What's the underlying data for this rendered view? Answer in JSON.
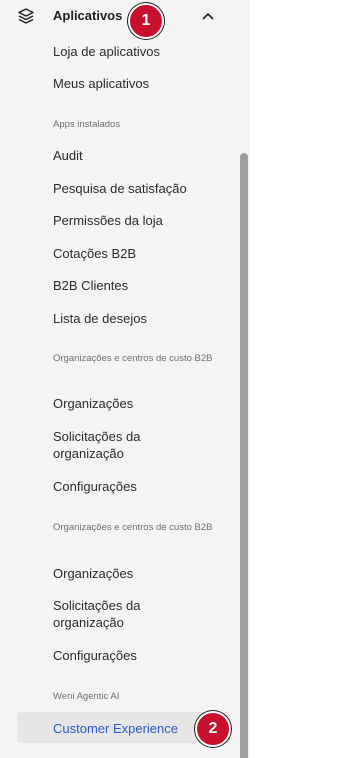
{
  "header": {
    "label": "Aplicativos",
    "icon": "layers-icon",
    "chevron": "chevron-up-icon"
  },
  "badges": [
    "1",
    "2"
  ],
  "items": {
    "loja": "Loja de aplicativos",
    "meus": "Meus aplicativos",
    "apps_section": "Apps instalados",
    "audit": "Audit",
    "pesquisa": "Pesquisa de satisfação",
    "permissoes": "Permissões da loja",
    "cotacoes": "Cotações B2B",
    "b2b_clientes": "B2B Clientes",
    "lista": "Lista de desejos",
    "org_section_1": "Organizações e centros de custo B2B",
    "organizacoes_1": "Organizações",
    "solicitacoes_1": "Solicitações da organização",
    "config_1": "Configurações",
    "org_section_2": "Organizações e centros de custo B2B",
    "organizacoes_2": "Organizações",
    "solicitacoes_2": "Solicitações da organização",
    "config_2": "Configurações",
    "weni_section": "Weni Agentic AI",
    "customer_experience": "Customer Experience"
  },
  "colors": {
    "badge": "#c8102e",
    "active_text": "#2b59c3",
    "active_bg": "#e6e6e6",
    "sidebar_bg": "#f4f4f4"
  }
}
